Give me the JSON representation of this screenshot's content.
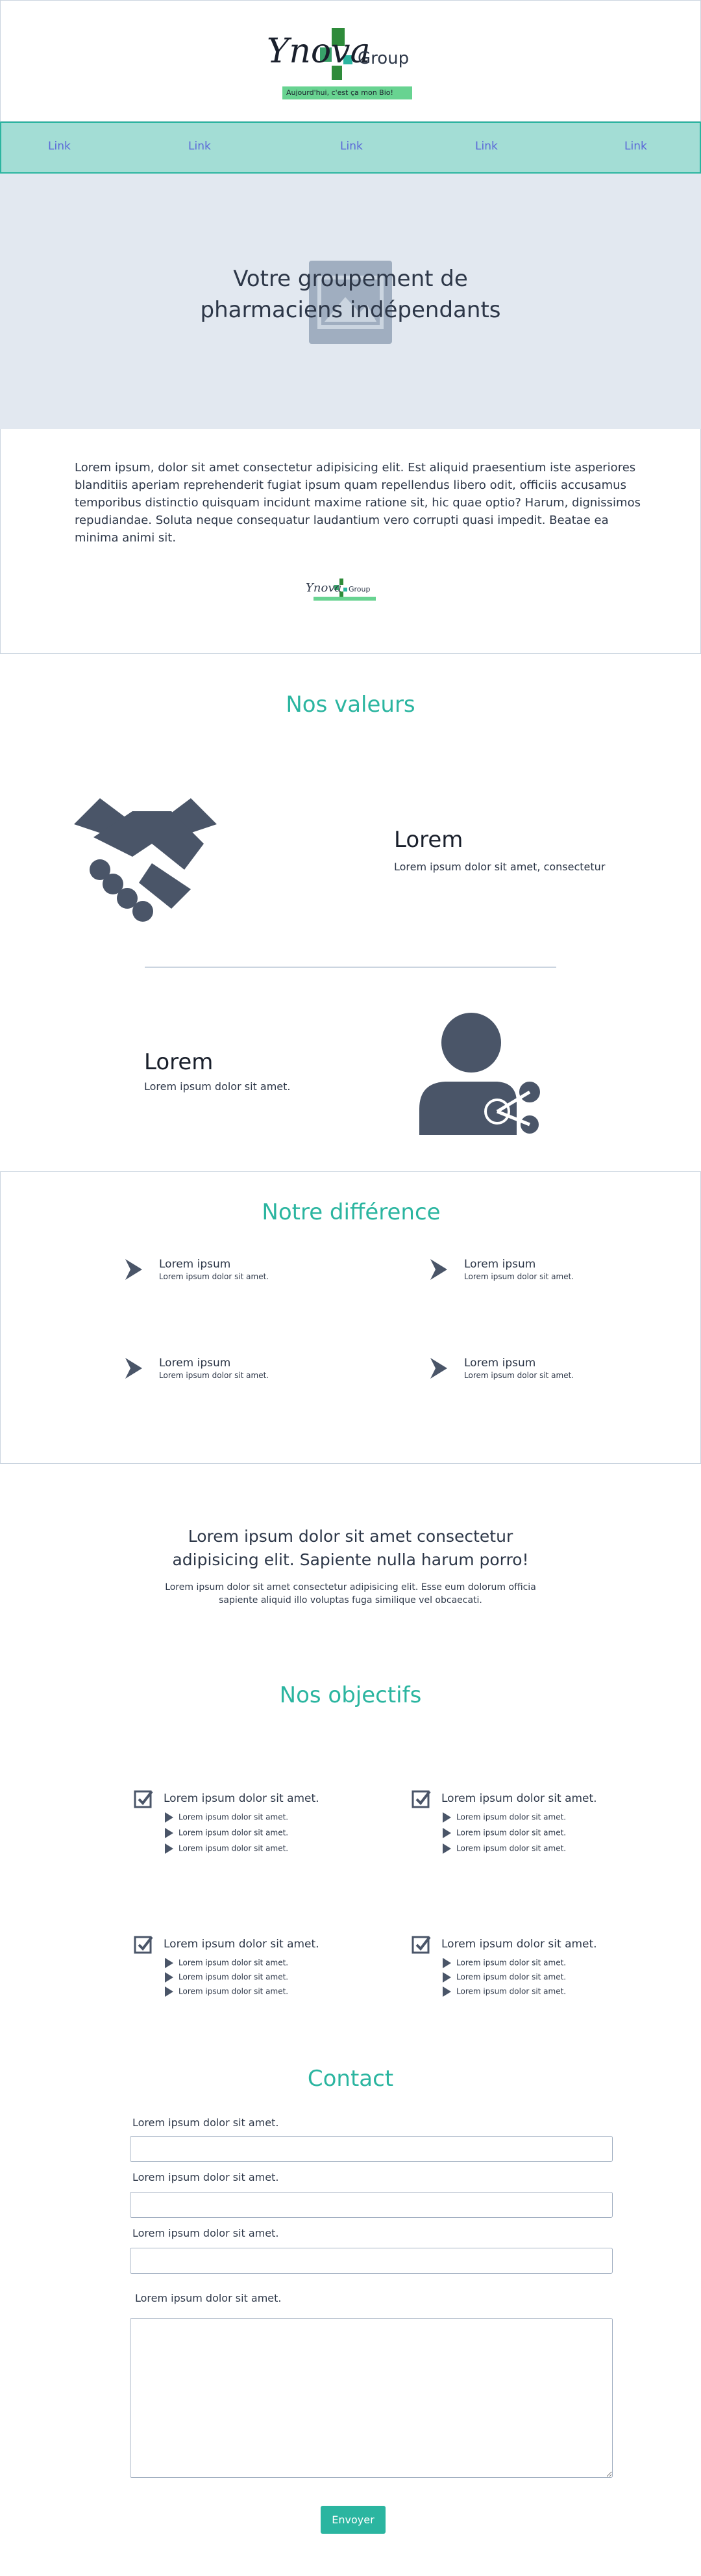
{
  "brand": {
    "logo_script": "Ynova",
    "logo_group": "Group",
    "tagline": "Aujourd'hui, c'est ça mon Bio!",
    "colors": {
      "teal": "#2bb5a0",
      "nav_bg": "#a3ddd5",
      "link": "#5a67d8",
      "icon": "#4a5568"
    }
  },
  "nav": {
    "links": [
      "Link",
      "Link",
      "Link",
      "Link",
      "Link"
    ]
  },
  "hero": {
    "title_line1": "Votre groupement de",
    "title_line2": "pharmaciens indépendants",
    "image_icon": "image-placeholder-icon"
  },
  "intro": {
    "text": "Lorem ipsum, dolor sit amet consectetur adipisicing elit. Est aliquid praesentium iste asperiores blanditiis aperiam reprehenderit fugiat ipsum quam repellendus libero odit, officiis accusamus temporibus distinctio quisquam incidunt maxime ratione sit, hic quae optio? Harum, dignissimos repudiandae. Soluta neque consequatur laudantium vero corrupti quasi impedit. Beatae ea minima animi sit."
  },
  "valeurs": {
    "title": "Nos valeurs",
    "items": [
      {
        "icon": "handshake-icon",
        "title": "Lorem",
        "text": "Lorem ipsum dolor sit amet, consectetur"
      },
      {
        "icon": "user-share-icon",
        "title": "Lorem",
        "text": "Lorem ipsum dolor sit amet."
      }
    ]
  },
  "difference": {
    "title": "Notre différence",
    "items": [
      {
        "title": "Lorem ipsum",
        "text": "Lorem ipsum dolor sit amet."
      },
      {
        "title": "Lorem ipsum",
        "text": "Lorem ipsum dolor sit amet."
      },
      {
        "title": "Lorem ipsum",
        "text": "Lorem ipsum dolor sit amet."
      },
      {
        "title": "Lorem ipsum",
        "text": "Lorem ipsum dolor sit amet."
      }
    ]
  },
  "banner": {
    "heading": "Lorem ipsum dolor sit amet consectetur adipisicing elit. Sapiente nulla harum porro!",
    "text": "Lorem ipsum dolor sit amet consectetur adipisicing elit. Esse eum dolorum officia sapiente aliquid illo voluptas fuga similique vel obcaecati."
  },
  "objectifs": {
    "title": "Nos objectifs",
    "groups": [
      {
        "title": "Lorem ipsum dolor sit amet.",
        "items": [
          "Lorem ipsum dolor sit amet.",
          "Lorem ipsum dolor sit amet.",
          "Lorem ipsum dolor sit amet."
        ]
      },
      {
        "title": "Lorem ipsum dolor sit amet.",
        "items": [
          "Lorem ipsum dolor sit amet.",
          "Lorem ipsum dolor sit amet.",
          "Lorem ipsum dolor sit amet."
        ]
      },
      {
        "title": "Lorem ipsum dolor sit amet.",
        "items": [
          "Lorem ipsum dolor sit amet.",
          "Lorem ipsum dolor sit amet.",
          "Lorem ipsum dolor sit amet."
        ]
      },
      {
        "title": "Lorem ipsum dolor sit amet.",
        "items": [
          "Lorem ipsum dolor sit amet.",
          "Lorem ipsum dolor sit amet.",
          "Lorem ipsum dolor sit amet."
        ]
      }
    ]
  },
  "contact": {
    "title": "Contact",
    "labels": [
      "Lorem ipsum dolor sit amet.",
      "Lorem ipsum dolor sit amet.",
      "Lorem ipsum dolor sit amet.",
      "Lorem ipsum dolor sit amet."
    ],
    "submit": "Envoyer"
  }
}
